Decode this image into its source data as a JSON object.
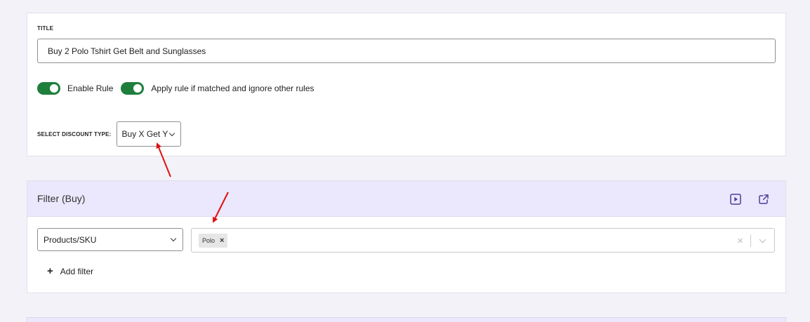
{
  "general": {
    "title_label": "TITLE",
    "title_value": "Buy 2 Polo Tshirt Get Belt and Sunglasses",
    "enable_rule_label": "Enable Rule",
    "apply_rule_label": "Apply rule if matched and ignore other rules",
    "enable_rule_on": true,
    "apply_rule_on": true,
    "discount_type_label": "SELECT DISCOUNT TYPE:",
    "discount_type_value": "Buy X Get Y"
  },
  "filter": {
    "header_title": "Filter (Buy)",
    "filter_type_value": "Products/SKU",
    "selected_tags": [
      "Polo"
    ],
    "add_filter_label": "Add filter"
  },
  "icons": {
    "tag_remove": "close-icon",
    "clear": "clear-icon",
    "dropdown": "chevron-down-icon",
    "play": "play-icon",
    "external": "external-link-icon",
    "add": "plus-icon"
  },
  "colors": {
    "page_background": "#f3f2f9",
    "toggle_on": "#1e7f3c",
    "filter_header_background": "#ebe7fc",
    "accent_icon": "#4a3f99",
    "annotation_arrow": "#e01010"
  }
}
